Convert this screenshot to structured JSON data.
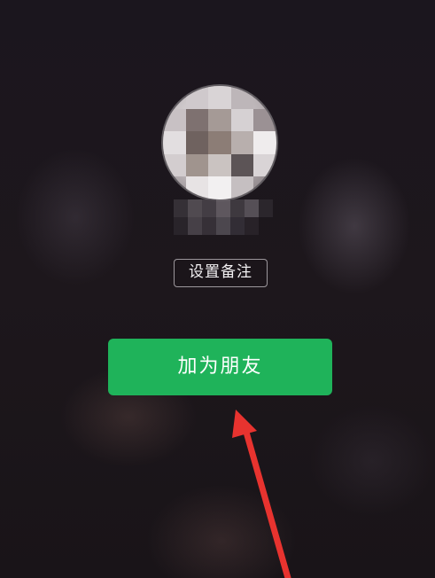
{
  "profile": {
    "avatar_icon": "user-avatar-pixelated",
    "name_icon": "nickname-pixelated"
  },
  "actions": {
    "set_remark_label": "设置备注",
    "add_friend_label": "加为朋友"
  },
  "annotation": {
    "arrow_icon": "red-pointer-arrow-icon",
    "arrow_color": "#e8332f"
  },
  "colors": {
    "background": "#1c161d",
    "primary_button": "#1fb35a",
    "primary_text": "#ffffff"
  }
}
